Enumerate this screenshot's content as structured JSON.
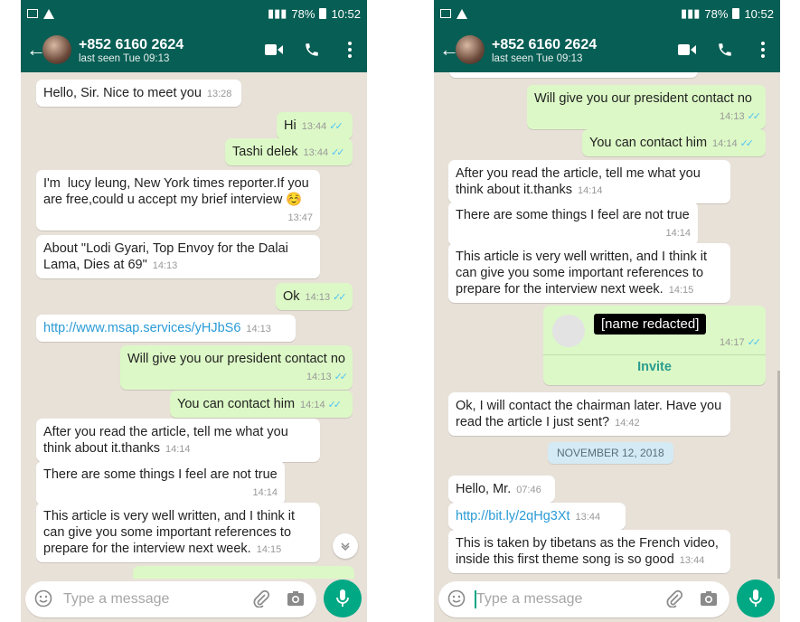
{
  "status_bar": {
    "battery": "78%",
    "time": "10:52"
  },
  "contact": {
    "name": "+852 6160 2624",
    "last_seen": "last seen Tue 09:13"
  },
  "input": {
    "placeholder": "Type a message"
  },
  "colors": {
    "header": "#075e54",
    "outgoing": "#dcf8c6",
    "incoming": "#ffffff",
    "accent": "#00a884",
    "tick": "#4fc3f7"
  },
  "screen1": {
    "messages": [
      {
        "dir": "in",
        "text": "Hello, Sir. Nice to meet you",
        "time": "13:28"
      },
      {
        "dir": "out",
        "text": "Hi",
        "time": "13:44"
      },
      {
        "dir": "out",
        "text": "Tashi delek",
        "time": "13:44"
      },
      {
        "dir": "in",
        "text": "I'm  lucy leung, New York times reporter.If you are free,could u accept my brief interview ☺️",
        "time": "13:47"
      },
      {
        "dir": "in",
        "text": "About \"Lodi Gyari, Top Envoy for the Dalai Lama, Dies at 69\"",
        "time": "14:13"
      },
      {
        "dir": "out",
        "text": "Ok",
        "time": "14:13"
      },
      {
        "dir": "in",
        "text": "http://www.msap.services/yHJbS6",
        "time": "14:13"
      },
      {
        "dir": "out",
        "text": "Will give you our president contact no",
        "time": "14:13"
      },
      {
        "dir": "out",
        "text": "You can contact him",
        "time": "14:14"
      },
      {
        "dir": "in",
        "text": "After you read the article, tell me what you think about it.thanks",
        "time": "14:14"
      },
      {
        "dir": "in",
        "text": "There are some things I feel are not true",
        "time": "14:14"
      },
      {
        "dir": "in",
        "text": "This article is very well written, and I think it can give you some important references to prepare for the interview next week.",
        "time": "14:15"
      }
    ]
  },
  "screen2": {
    "messages": [
      {
        "dir": "out",
        "text": "Will give you our president contact no",
        "time": "14:13"
      },
      {
        "dir": "out",
        "text": "You can contact him",
        "time": "14:14"
      },
      {
        "dir": "in",
        "text": "After you read the article, tell me what you think about it.thanks",
        "time": "14:14"
      },
      {
        "dir": "in",
        "text": "There are some things I feel are not true",
        "time": "14:14"
      },
      {
        "dir": "in",
        "text": "This article is very well written, and I think it can give you some important references to prepare for the interview next week.",
        "time": "14:15"
      },
      {
        "dir": "in",
        "text": "Ok, I will contact the chairman later. Have you read the article I just sent?",
        "time": "14:42"
      },
      {
        "dir": "in",
        "text": "Hello, Mr.",
        "time": "07:46"
      },
      {
        "dir": "in",
        "text": "http://bit.ly/2qHg3Xt",
        "time": "13:44"
      },
      {
        "dir": "in",
        "text": "This is taken by tibetans as the French video, inside this first theme song is so good",
        "time": "13:44"
      }
    ],
    "contact_card": {
      "name": "[name redacted]",
      "time": "14:17",
      "action": "Invite"
    },
    "date_chip": "NOVEMBER 12, 2018"
  }
}
